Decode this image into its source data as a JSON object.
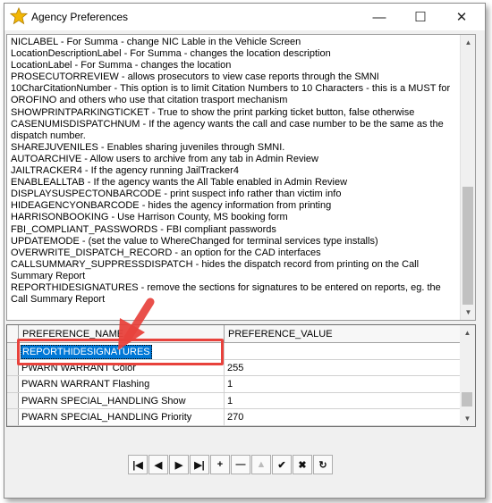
{
  "window": {
    "title": "Agency Preferences",
    "icons": {
      "app": "star-icon",
      "minimize": "minimize-icon",
      "maximize": "maximize-icon",
      "close": "close-icon"
    },
    "glyphs": {
      "minimize": "—",
      "maximize": "☐",
      "close": "✕"
    }
  },
  "descriptions": [
    "NICLABEL - For Summa - change NIC Lable in the Vehicle Screen",
    "LocationDescriptionLabel - For Summa - changes the location description",
    "LocationLabel - For Summa - changes the location",
    "PROSECUTORREVIEW - allows prosecutors to view case reports through the SMNI",
    "10CharCitationNumber - This option is to limit Citation Numbers to 10 Characters - this is a MUST for OROFINO and others who use that citation trasport mechanism",
    "SHOWPRINTPARKINGTICKET - True to show the print parking ticket button, false otherwise",
    "CASENUMISDISPATCHNUM - If the agency wants the call and case number to be the same as the dispatch number.",
    "SHAREJUVENILES - Enables sharing juveniles through SMNI.",
    "AUTOARCHIVE - Allow users to archive from any tab in Admin Review",
    "JAILTRACKER4 - If the agency running JailTracker4",
    "ENABLEALLTAB - If the agency wants the All Table enabled in Admin Review",
    "DISPLAYSUSPECTONBARCODE - print suspect info rather than victim info",
    "HIDEAGENCYONBARCODE      - hides the agency information from printing",
    "HARRISONBOOKING - Use Harrison County, MS booking form",
    "FBI_COMPLIANT_PASSWORDS - FBI compliant passwords",
    "UPDATEMODE - (set the value to WhereChanged for terminal services type installs)",
    "OVERWRITE_DISPATCH_RECORD - an option for the CAD interfaces",
    "CALLSUMMARY_SUPPRESSDISPATCH - hides the dispatch record from printing on the Call Summary Report",
    "REPORTHIDESIGNATURES - remove the sections for signatures to be entered on reports, eg. the Call Summary Report"
  ],
  "grid": {
    "columns": [
      "PREFERENCE_NAME",
      "PREFERENCE_VALUE"
    ],
    "rows": [
      {
        "name": "REPORTHIDESIGNATURES",
        "value": ""
      },
      {
        "name": "PWARN WARRANT Color",
        "value": "255"
      },
      {
        "name": "PWARN WARRANT Flashing",
        "value": "1"
      },
      {
        "name": "PWARN SPECIAL_HANDLING Show",
        "value": "1"
      },
      {
        "name": "PWARN SPECIAL_HANDLING Priority",
        "value": "270"
      }
    ],
    "editing_row": 0
  },
  "navigator": [
    {
      "name": "first-record-button",
      "icon": "first-icon",
      "glyph": "|◀"
    },
    {
      "name": "prior-record-button",
      "icon": "prior-icon",
      "glyph": "◀"
    },
    {
      "name": "next-record-button",
      "icon": "next-icon",
      "glyph": "▶"
    },
    {
      "name": "last-record-button",
      "icon": "last-icon",
      "glyph": "▶|"
    },
    {
      "name": "insert-record-button",
      "icon": "plus-icon",
      "glyph": "+"
    },
    {
      "name": "delete-record-button",
      "icon": "minus-icon",
      "glyph": "—"
    },
    {
      "name": "edit-record-button",
      "icon": "edit-icon",
      "glyph": "▲",
      "disabled": true
    },
    {
      "name": "post-record-button",
      "icon": "check-icon",
      "glyph": "✔"
    },
    {
      "name": "cancel-record-button",
      "icon": "cancel-icon",
      "glyph": "✖"
    },
    {
      "name": "refresh-button",
      "icon": "refresh-icon",
      "glyph": "↻"
    }
  ],
  "colors": {
    "accent": "#0078d7",
    "annotation": "#e8423c"
  }
}
